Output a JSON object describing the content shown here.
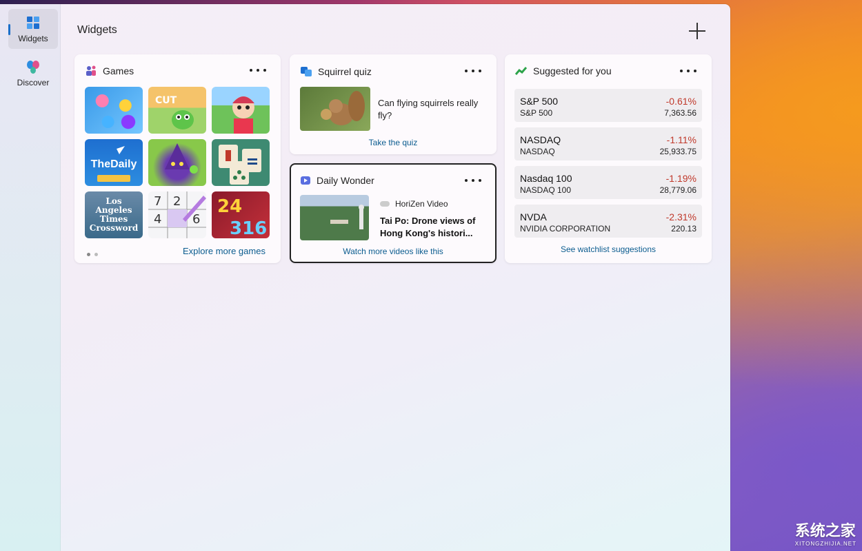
{
  "sidebar": {
    "items": [
      {
        "label": "Widgets",
        "icon": "widgets-icon"
      },
      {
        "label": "Discover",
        "icon": "discover-icon"
      }
    ]
  },
  "header": {
    "title": "Widgets",
    "add_icon": "plus-icon"
  },
  "games": {
    "title": "Games",
    "tiles": [
      {
        "name": "candy-crush",
        "label": ""
      },
      {
        "name": "cut-the-rope",
        "label": ""
      },
      {
        "name": "hotel-game",
        "label": ""
      },
      {
        "name": "the-daily-crossword",
        "label": "TheDaily"
      },
      {
        "name": "wizard-game",
        "label": ""
      },
      {
        "name": "mahjong",
        "label": ""
      },
      {
        "name": "la-times-crossword",
        "label": "Los Angeles Times Crossword"
      },
      {
        "name": "sudoku",
        "label": ""
      },
      {
        "name": "2048",
        "label": ""
      }
    ],
    "explore_link": "Explore more games"
  },
  "quiz": {
    "title": "Squirrel quiz",
    "question": "Can flying squirrels really fly?",
    "action": "Take the quiz"
  },
  "wonder": {
    "title": "Daily Wonder",
    "source": "HoriZen Video",
    "headline": "Tai Po: Drone views of Hong Kong's histori...",
    "action": "Watch more videos like this"
  },
  "stocks": {
    "title": "Suggested for you",
    "items": [
      {
        "symbol": "S&P 500",
        "name": "S&P 500",
        "change": "-0.61%",
        "price": "7,363.56"
      },
      {
        "symbol": "NASDAQ",
        "name": "NASDAQ",
        "change": "-1.11%",
        "price": "25,933.75"
      },
      {
        "symbol": "Nasdaq 100",
        "name": "NASDAQ 100",
        "change": "-1.19%",
        "price": "28,779.06"
      },
      {
        "symbol": "NVDA",
        "name": "NVIDIA CORPORATION",
        "change": "-2.31%",
        "price": "220.13"
      }
    ],
    "action": "See watchlist suggestions"
  },
  "watermark": {
    "cn": "系统之家",
    "en": "XITONGZHIJIA.NET"
  },
  "colors": {
    "accent": "#1a6fc9",
    "negative": "#c0392b",
    "link": "#0b5c8f"
  }
}
